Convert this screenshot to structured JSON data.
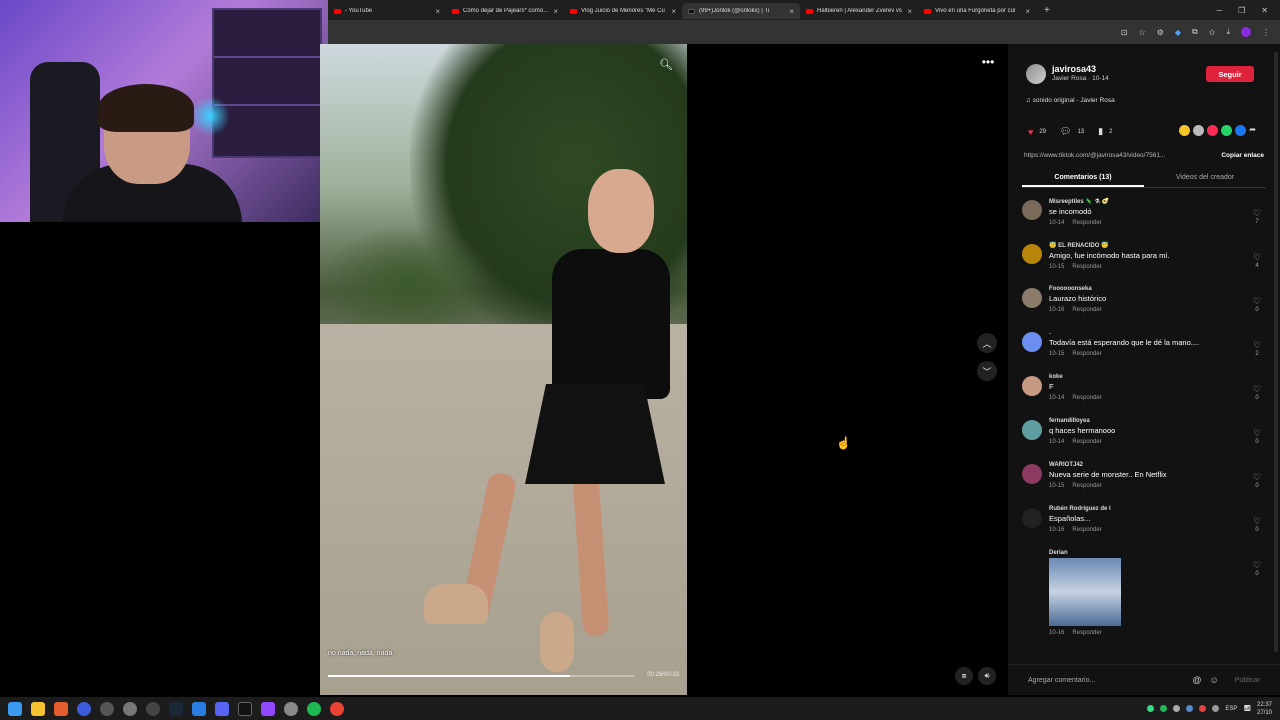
{
  "browser": {
    "tabs": [
      {
        "label": "- YouTube",
        "active": false,
        "kind": "youtube"
      },
      {
        "label": "Cómo dejar de Pajears* como un",
        "active": false,
        "kind": "youtube"
      },
      {
        "label": "Vlog Juicio de Menores \"Me Cu",
        "active": false,
        "kind": "youtube"
      },
      {
        "label": "(99+)Jonlok (@onlokx) | Ti",
        "active": true,
        "kind": "tiktok"
      },
      {
        "label": "Halbieren | Alexander Zverev vs",
        "active": false,
        "kind": "youtube"
      },
      {
        "label": "Vivo en una Furgoneta por cul",
        "active": false,
        "kind": "youtube"
      }
    ],
    "new_tab": "+"
  },
  "video": {
    "caption": "no nada, nada, nada.",
    "timecode": "00:26/00:33",
    "progress_fraction": 0.79
  },
  "panel": {
    "username": "javirosa43",
    "subtitle": "Javier Rosa · 10-14",
    "follow_label": "Seguir",
    "sound": "♫  sonido original - Javier Rosa",
    "likes": "29",
    "comments_count": "13",
    "saves": "2",
    "url": "https://www.tiktok.com/@javirosa43/video/7561...",
    "copy_label": "Copiar enlace",
    "tab_comments": "Comentarios (13)",
    "tab_creator": "Videos del creador",
    "comments": [
      {
        "name": "Misreeptiles 🦎 ⚗ 🥑",
        "text": "se incomodó",
        "date": "10-14",
        "likes": "7",
        "color": "#7a6a5a"
      },
      {
        "name": "😇 EL RENACIDO 😇",
        "text": "Amigo, fue incómodo hasta para mí.",
        "date": "10-15",
        "likes": "4",
        "color": "#b8860b"
      },
      {
        "name": "Foooooonseka",
        "text": "Laurazo histórico",
        "date": "10-16",
        "likes": "0",
        "color": "#8a7b6b"
      },
      {
        "name": ".",
        "text": "Todavía está esperando que le dé la mano....",
        "date": "10-15",
        "likes": "2",
        "color": "#6b8ef0"
      },
      {
        "name": "koke",
        "text": "F",
        "date": "10-14",
        "likes": "0",
        "color": "#c79a84"
      },
      {
        "name": "fernandilloyea",
        "text": "q haces hermanooo",
        "date": "10-14",
        "likes": "0",
        "color": "#5f9ea0"
      },
      {
        "name": "WARIOTJ42",
        "text": "Nueva serie de monster.. En Netflix",
        "date": "10-15",
        "likes": "0",
        "color": "#8b3a62"
      },
      {
        "name": "Rubén Rodríguez de l",
        "text": "Españolas...",
        "date": "10-16",
        "likes": "0",
        "color": "#222222"
      },
      {
        "name": "Derian",
        "text": "",
        "date": "10-16",
        "likes": "0",
        "color": "#111111",
        "has_image": true
      }
    ],
    "reply_label": "Responder",
    "add_comment_placeholder": "Agregar comentario...",
    "post_label": "Publicar"
  },
  "taskbar": {
    "lang": "ESP",
    "time": "22:37",
    "date": "27/10"
  },
  "colors": {
    "accent": "#fe2c55",
    "follow": "#e0233c"
  }
}
